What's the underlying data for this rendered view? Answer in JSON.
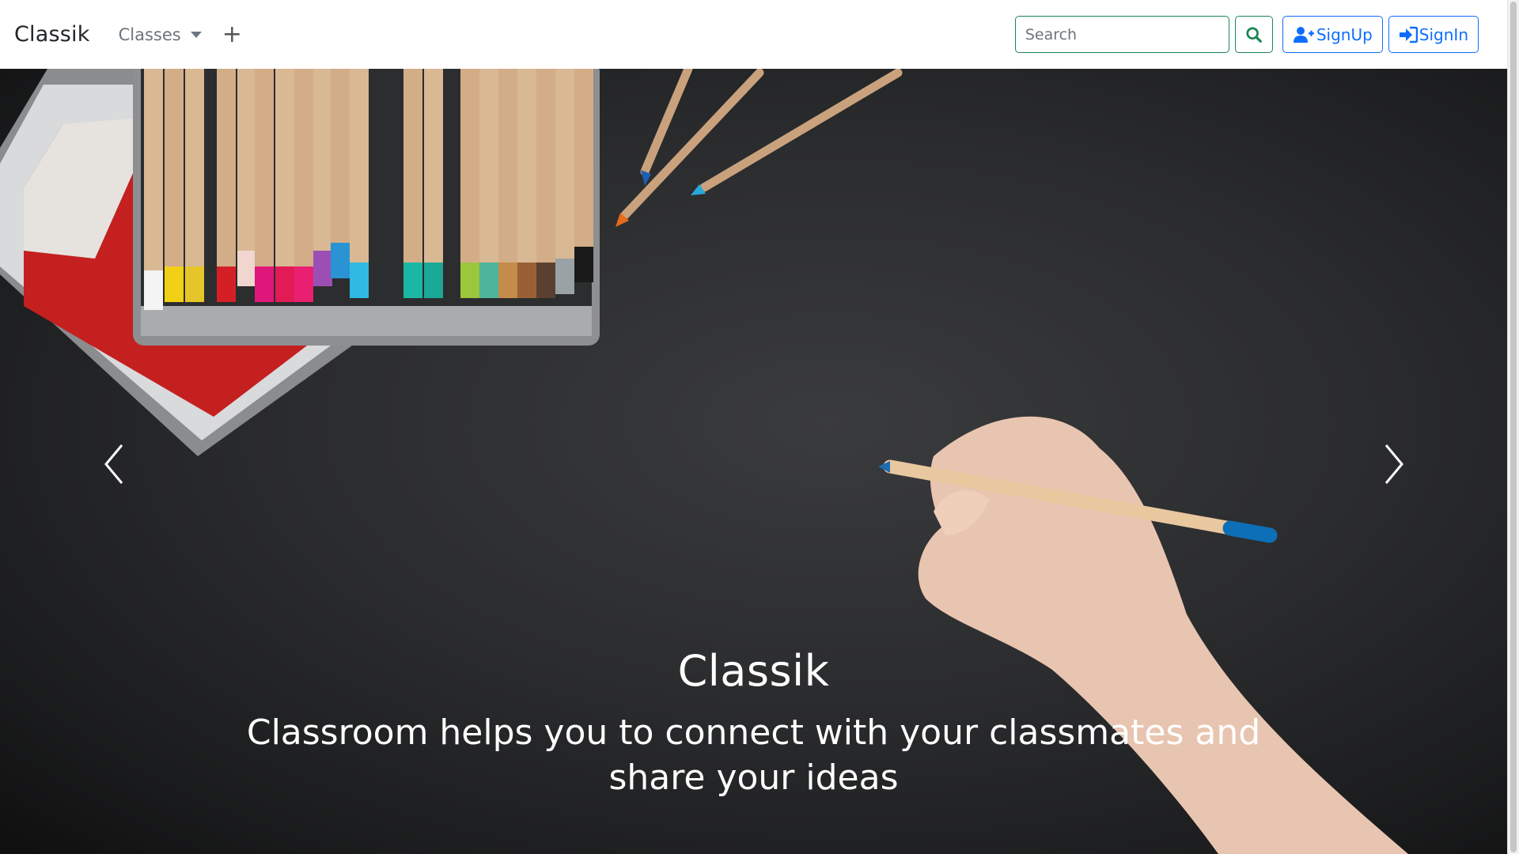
{
  "navbar": {
    "brand": "Classik",
    "classes_label": "Classes",
    "plus_symbol": "+",
    "search_placeholder": "Search",
    "signup_label": "SignUp",
    "signin_label": "SignIn"
  },
  "hero": {
    "title": "Classik",
    "subtitle": "Classroom helps you to connect with your classmates and share your ideas"
  },
  "icons": {
    "search": "search-icon",
    "signup": "user-plus-icon",
    "signin": "sign-in-icon",
    "prev": "chevron-left-icon",
    "next": "chevron-right-icon"
  },
  "colors": {
    "search_accent": "#198754",
    "auth_accent": "#0d6efd",
    "hero_background": "#2b2c2e"
  }
}
